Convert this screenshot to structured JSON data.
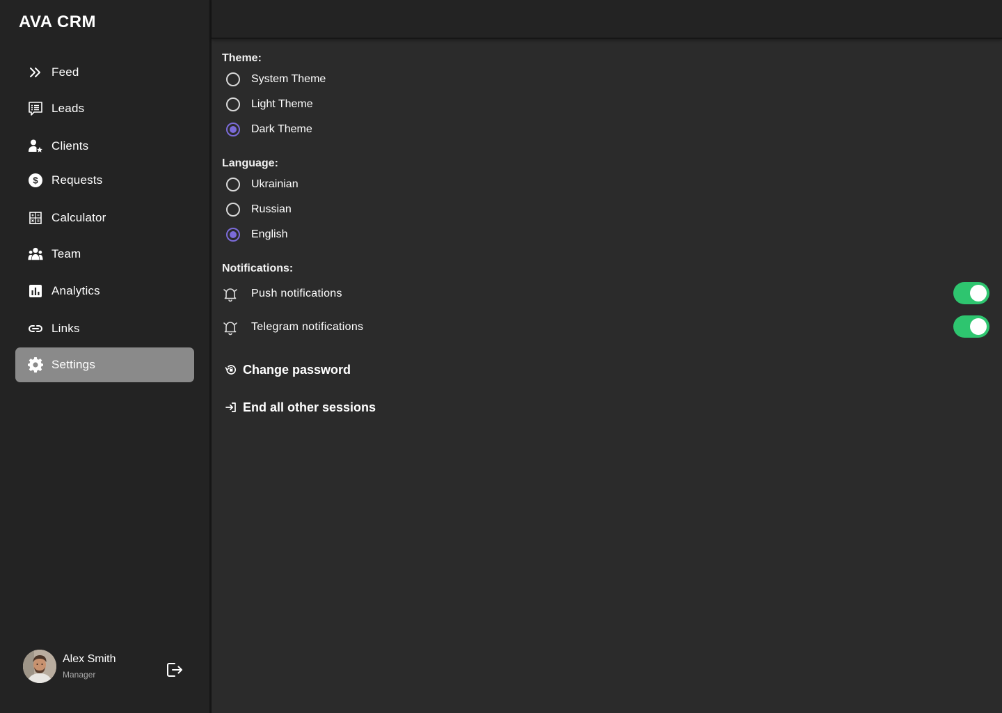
{
  "app": {
    "title": "AVA CRM"
  },
  "sidebar": {
    "items": [
      {
        "label": "Feed",
        "icon": "double-chevron-right-icon"
      },
      {
        "label": "Leads",
        "icon": "chat-list-icon"
      },
      {
        "label": "Clients",
        "icon": "user-star-icon"
      },
      {
        "label": "Requests",
        "icon": "dollar-circle-icon"
      },
      {
        "label": "Calculator",
        "icon": "calculator-icon"
      },
      {
        "label": "Team",
        "icon": "team-icon"
      },
      {
        "label": "Analytics",
        "icon": "bar-chart-icon"
      },
      {
        "label": "Links",
        "icon": "link-icon"
      },
      {
        "label": "Settings",
        "icon": "gear-icon",
        "active": true
      }
    ],
    "user": {
      "name": "Alex Smith",
      "role": "Manager"
    }
  },
  "settings": {
    "theme": {
      "title": "Theme:",
      "options": [
        {
          "label": "System Theme",
          "checked": false
        },
        {
          "label": "Light Theme",
          "checked": false
        },
        {
          "label": "Dark Theme",
          "checked": true
        }
      ]
    },
    "language": {
      "title": "Language:",
      "options": [
        {
          "label": "Ukrainian",
          "checked": false
        },
        {
          "label": "Russian",
          "checked": false
        },
        {
          "label": "English",
          "checked": true
        }
      ]
    },
    "notifications": {
      "title": "Notifications:",
      "items": [
        {
          "label": "Push notifications",
          "enabled": true
        },
        {
          "label": "Telegram notifications",
          "enabled": true
        }
      ]
    },
    "actions": {
      "change_password": "Change password",
      "end_sessions": "End all other sessions"
    }
  },
  "colors": {
    "accent": "#7b6bd8",
    "toggle_on": "#2ec56f",
    "sidebar_bg": "#232323",
    "content_bg": "#2b2b2b",
    "active_item_bg": "#8a8a8a"
  }
}
